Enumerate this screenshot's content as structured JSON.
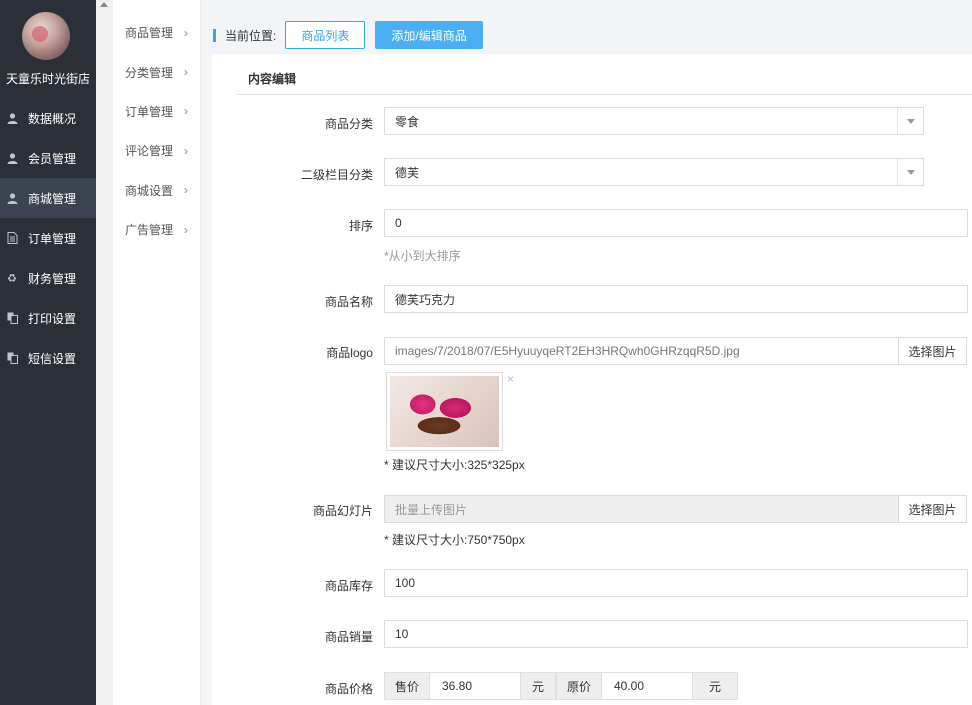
{
  "sidebar": {
    "store_name": "天童乐时光街店",
    "items": [
      {
        "label": "数据概况",
        "icon": "user-icon"
      },
      {
        "label": "会员管理",
        "icon": "user-icon"
      },
      {
        "label": "商城管理",
        "icon": "user-icon",
        "active": true
      },
      {
        "label": "订单管理",
        "icon": "document-icon"
      },
      {
        "label": "财务管理",
        "icon": "recycle-icon"
      },
      {
        "label": "打印设置",
        "icon": "copy-icon"
      },
      {
        "label": "短信设置",
        "icon": "copy-icon"
      }
    ]
  },
  "submenu": {
    "items": [
      {
        "label": "商品管理"
      },
      {
        "label": "分类管理"
      },
      {
        "label": "订单管理"
      },
      {
        "label": "评论管理"
      },
      {
        "label": "商城设置"
      },
      {
        "label": "广告管理"
      }
    ]
  },
  "breadcrumb": {
    "label": "当前位置:",
    "list_button": "商品列表",
    "edit_button": "添加/编辑商品"
  },
  "form": {
    "title": "内容编辑",
    "category": {
      "label": "商品分类",
      "value": "零食"
    },
    "subcategory": {
      "label": "二级栏目分类",
      "value": "德芙"
    },
    "sort": {
      "label": "排序",
      "value": "0",
      "hint": "*从小到大排序"
    },
    "name": {
      "label": "商品名称",
      "value": "德芙巧克力"
    },
    "logo": {
      "label": "商品logo",
      "value": "images/7/2018/07/E5HyuuyqeRT2EH3HRQwh0GHRzqqR5D.jpg",
      "pick_button": "选择图片",
      "close_glyph": "×",
      "hint": "* 建议尺寸大小:325*325px"
    },
    "slides": {
      "label": "商品幻灯片",
      "placeholder": "批量上传图片",
      "pick_button": "选择图片",
      "hint": "* 建议尺寸大小:750*750px"
    },
    "stock": {
      "label": "商品库存",
      "value": "100"
    },
    "sales": {
      "label": "商品销量",
      "value": "10"
    },
    "price": {
      "label": "商品价格",
      "sale_label": "售价",
      "sale_value": "36.80",
      "unit1": "元",
      "original_label": "原价",
      "original_value": "40.00",
      "unit2": "元"
    }
  },
  "colors": {
    "sidebar_bg": "#2b3038",
    "accent": "#3ba3e6",
    "primary_button": "#4aaef0"
  }
}
